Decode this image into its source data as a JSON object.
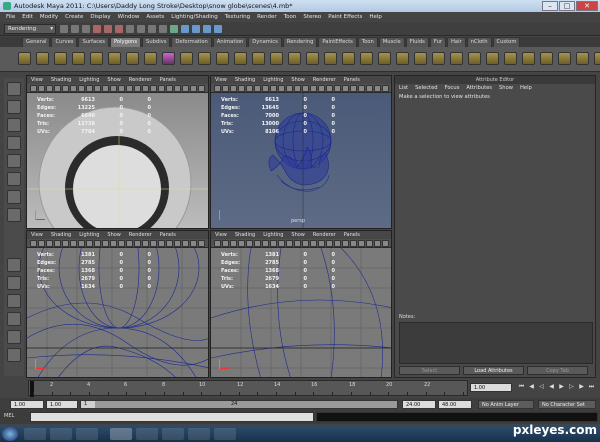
{
  "window": {
    "title": "Autodesk Maya 2011: C:\\Users\\Daddy Long Stroke\\Desktop\\snow globe\\scenes\\4.mb*",
    "controls": [
      "minimize-icon",
      "maximize-icon",
      "close-icon"
    ]
  },
  "menubar": [
    "File",
    "Edit",
    "Modify",
    "Create",
    "Display",
    "Window",
    "Assets",
    "Lighting/Shading",
    "Texturing",
    "Render",
    "Toon",
    "Stereo",
    "Paint Effects",
    "Help"
  ],
  "statusline": {
    "mode": "Rendering"
  },
  "shelf_tabs": [
    "General",
    "Curves",
    "Surfaces",
    "Polygons",
    "Subdivs",
    "Deformation",
    "Animation",
    "Dynamics",
    "Rendering",
    "PaintEffects",
    "Toon",
    "Muscle",
    "Fluids",
    "Fur",
    "Hair",
    "nCloth",
    "Custom"
  ],
  "active_shelf_tab": "Polygons",
  "panel_menu": [
    "View",
    "Shading",
    "Lighting",
    "Show",
    "Renderer",
    "Panels"
  ],
  "hud_labels": [
    "Verts:",
    "Edges:",
    "Faces:",
    "Tris:",
    "UVs:"
  ],
  "viewports": [
    {
      "name": "top-left",
      "stats": [
        [
          "6613",
          "0",
          "0"
        ],
        [
          "13225",
          "0",
          "0"
        ],
        [
          "6640",
          "0",
          "0"
        ],
        [
          "12738",
          "0",
          "0"
        ],
        [
          "7784",
          "0",
          "0"
        ]
      ],
      "label": "top"
    },
    {
      "name": "top-right",
      "stats": [
        [
          "6613",
          "0",
          "0"
        ],
        [
          "13645",
          "0",
          "0"
        ],
        [
          "7000",
          "0",
          "0"
        ],
        [
          "13000",
          "0",
          "0"
        ],
        [
          "8106",
          "0",
          "0"
        ]
      ],
      "label": "persp"
    },
    {
      "name": "bottom-left",
      "stats": [
        [
          "1381",
          "0",
          "0"
        ],
        [
          "2785",
          "0",
          "0"
        ],
        [
          "1368",
          "0",
          "0"
        ],
        [
          "2679",
          "0",
          "0"
        ],
        [
          "1634",
          "0",
          "0"
        ]
      ],
      "label": ""
    },
    {
      "name": "bottom-right",
      "stats": [
        [
          "1381",
          "0",
          "0"
        ],
        [
          "2785",
          "0",
          "0"
        ],
        [
          "1368",
          "0",
          "0"
        ],
        [
          "2679",
          "0",
          "0"
        ],
        [
          "1634",
          "0",
          "0"
        ]
      ],
      "label": ""
    }
  ],
  "attribute_editor": {
    "title": "Attribute Editor",
    "menu": [
      "List",
      "Selected",
      "Focus",
      "Attributes",
      "Show",
      "Help"
    ],
    "message": "Make a selection to view attributes",
    "notes_label": "Notes:",
    "buttons": [
      "Select",
      "Load Attributes",
      "Copy Tab"
    ]
  },
  "timeline": {
    "ticks": [
      "2",
      "4",
      "6",
      "8",
      "10",
      "12",
      "14",
      "16",
      "18",
      "20",
      "22"
    ],
    "current_frame": "1.00"
  },
  "range": {
    "start_time": "1.00",
    "start_range": "1.00",
    "range_start_marker": "1",
    "range_end_marker": "24",
    "end_range": "24.00",
    "end_time": "48.00",
    "anim_layer": "No Anim Layer",
    "character_set": "No Character Set"
  },
  "command_line": {
    "label": "MEL"
  },
  "watermark": "pxleyes.com"
}
